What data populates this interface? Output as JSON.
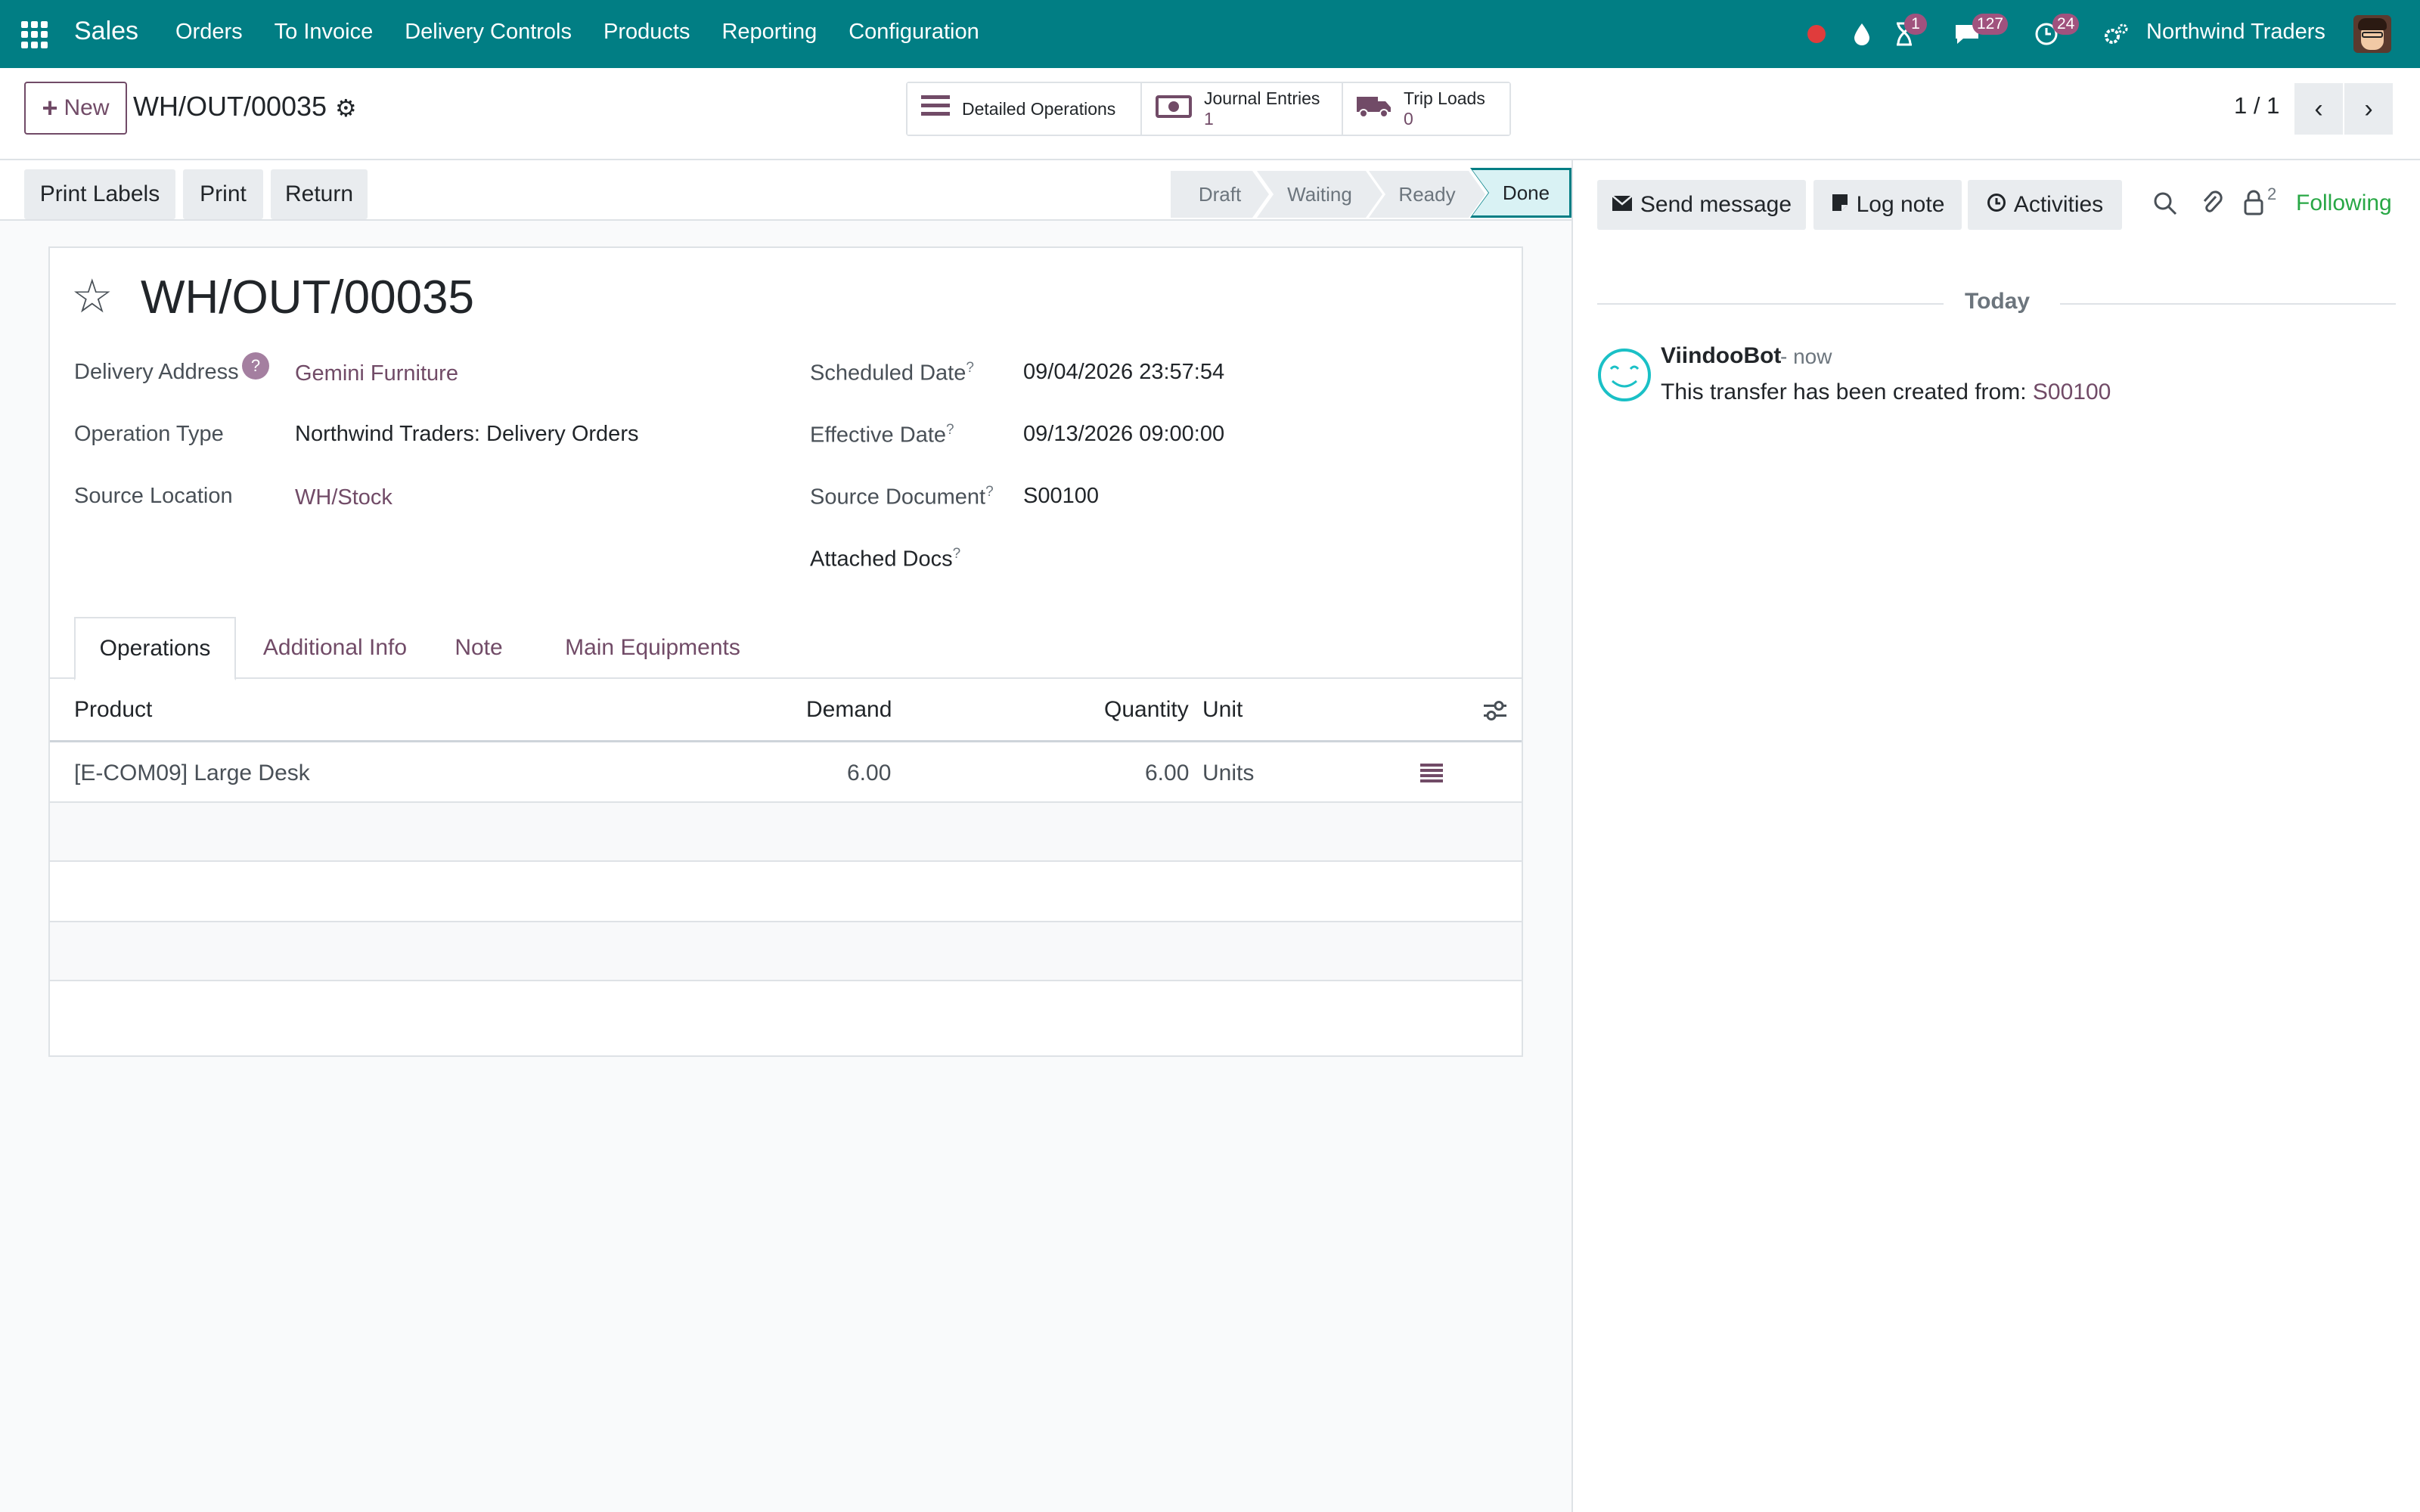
{
  "navbar": {
    "app_name": "Sales",
    "menu": [
      "Orders",
      "To Invoice",
      "Delivery Controls",
      "Products",
      "Reporting",
      "Configuration"
    ],
    "activity_badge": "1",
    "messages_badge": "127",
    "clock_badge": "24",
    "company": "Northwind Traders"
  },
  "control": {
    "new_label": "New",
    "breadcrumb": "WH/OUT/00035",
    "smart_buttons": {
      "detailed_ops": "Detailed Operations",
      "journal_label": "Journal Entries",
      "journal_value": "1",
      "trip_label": "Trip Loads",
      "trip_value": "0"
    },
    "pager": "1 / 1"
  },
  "actions": {
    "print_labels": "Print Labels",
    "print": "Print",
    "return": "Return"
  },
  "status": {
    "stages": [
      "Draft",
      "Waiting",
      "Ready",
      "Done"
    ],
    "current": "Done"
  },
  "form": {
    "title": "WH/OUT/00035",
    "left": {
      "delivery_address_label": "Delivery Address",
      "delivery_address_help": "?",
      "delivery_address": "Gemini Furniture",
      "operation_type_label": "Operation Type",
      "operation_type": "Northwind Traders: Delivery Orders",
      "source_location_label": "Source Location",
      "source_location": "WH/Stock"
    },
    "right": {
      "scheduled_date_label": "Scheduled Date",
      "scheduled_date": "09/04/2026 23:57:54",
      "effective_date_label": "Effective Date",
      "effective_date": "09/13/2026 09:00:00",
      "source_document_label": "Source Document",
      "source_document": "S00100",
      "attached_docs_label": "Attached Docs",
      "help_mark": "?"
    },
    "tabs": [
      "Operations",
      "Additional Info",
      "Note",
      "Main Equipments"
    ],
    "table": {
      "headers": [
        "Product",
        "Demand",
        "Quantity",
        "Unit"
      ],
      "rows": [
        {
          "product": "[E-COM09] Large Desk",
          "demand": "6.00",
          "quantity": "6.00",
          "unit": "Units"
        }
      ]
    }
  },
  "chatter": {
    "send_message": "Send message",
    "log_note": "Log note",
    "activities": "Activities",
    "followers_count": "2",
    "following": "Following",
    "date_separator": "Today",
    "messages": [
      {
        "author": "ViindooBot",
        "time": "- now",
        "body": "This transfer has been created from: ",
        "link": "S00100"
      }
    ]
  },
  "colors": {
    "navbar": "#017e84",
    "primary": "#714b67",
    "following": "#28a745"
  }
}
